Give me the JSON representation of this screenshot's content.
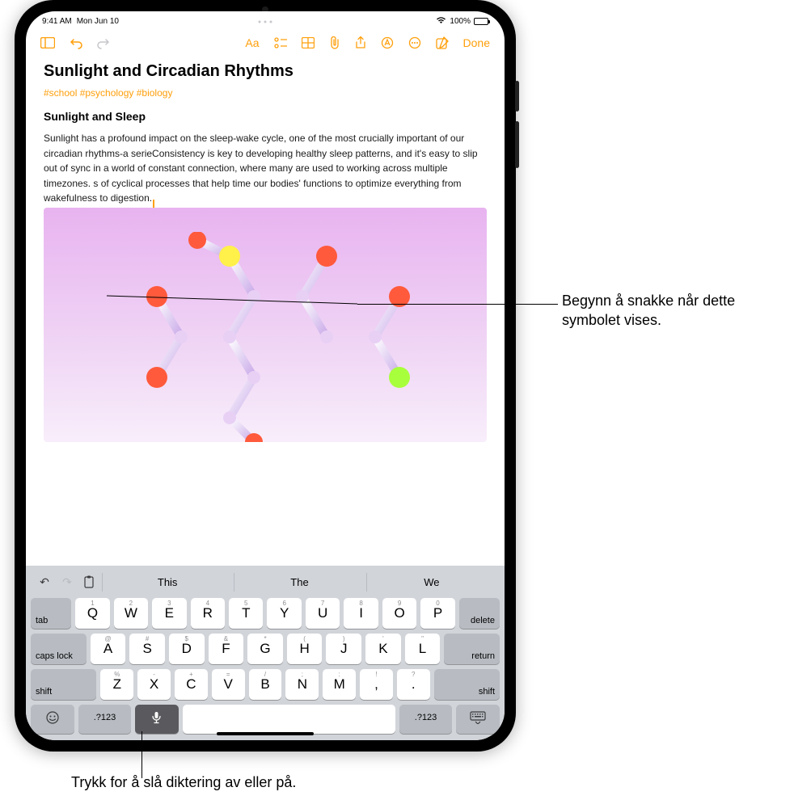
{
  "status": {
    "time": "9:41 AM",
    "date": "Mon Jun 10",
    "battery_pct": "100%"
  },
  "toolbar": {
    "done": "Done"
  },
  "note": {
    "title": "Sunlight and Circadian Rhythms",
    "tags": "#school #psychology #biology",
    "heading": "Sunlight and Sleep",
    "body": "Sunlight has a profound impact on the sleep-wake cycle, one of the most crucially important of our circadian rhythms-a serieConsistency is key to developing healthy sleep patterns, and it's easy to slip out of sync in a world of constant connection, where many are used to working across multiple timezones. s of cyclical processes that help time our bodies' functions to optimize everything from wakefulness to digestion."
  },
  "suggestions": [
    "This",
    "The",
    "We"
  ],
  "keyboard": {
    "row1_hints": [
      "1",
      "2",
      "3",
      "4",
      "5",
      "6",
      "7",
      "8",
      "9",
      "0"
    ],
    "row1": [
      "Q",
      "W",
      "E",
      "R",
      "T",
      "Y",
      "U",
      "I",
      "O",
      "P"
    ],
    "row2_hints": [
      "@",
      "#",
      "$",
      "&",
      "*",
      "(",
      ")",
      "'",
      "\""
    ],
    "row2": [
      "A",
      "S",
      "D",
      "F",
      "G",
      "H",
      "J",
      "K",
      "L"
    ],
    "row3_hints": [
      "%",
      "-",
      "+",
      "=",
      "/",
      ";",
      ":",
      "!",
      "?"
    ],
    "row3": [
      "Z",
      "X",
      "C",
      "V",
      "B",
      "N",
      "M",
      ",",
      "."
    ],
    "tab": "tab",
    "delete": "delete",
    "caps": "caps lock",
    "return": "return",
    "shift": "shift",
    "numsym": ".?123"
  },
  "callouts": {
    "c1": "Begynn å snakke når dette symbolet vises.",
    "c2": "Trykk for å slå diktering av eller på."
  }
}
